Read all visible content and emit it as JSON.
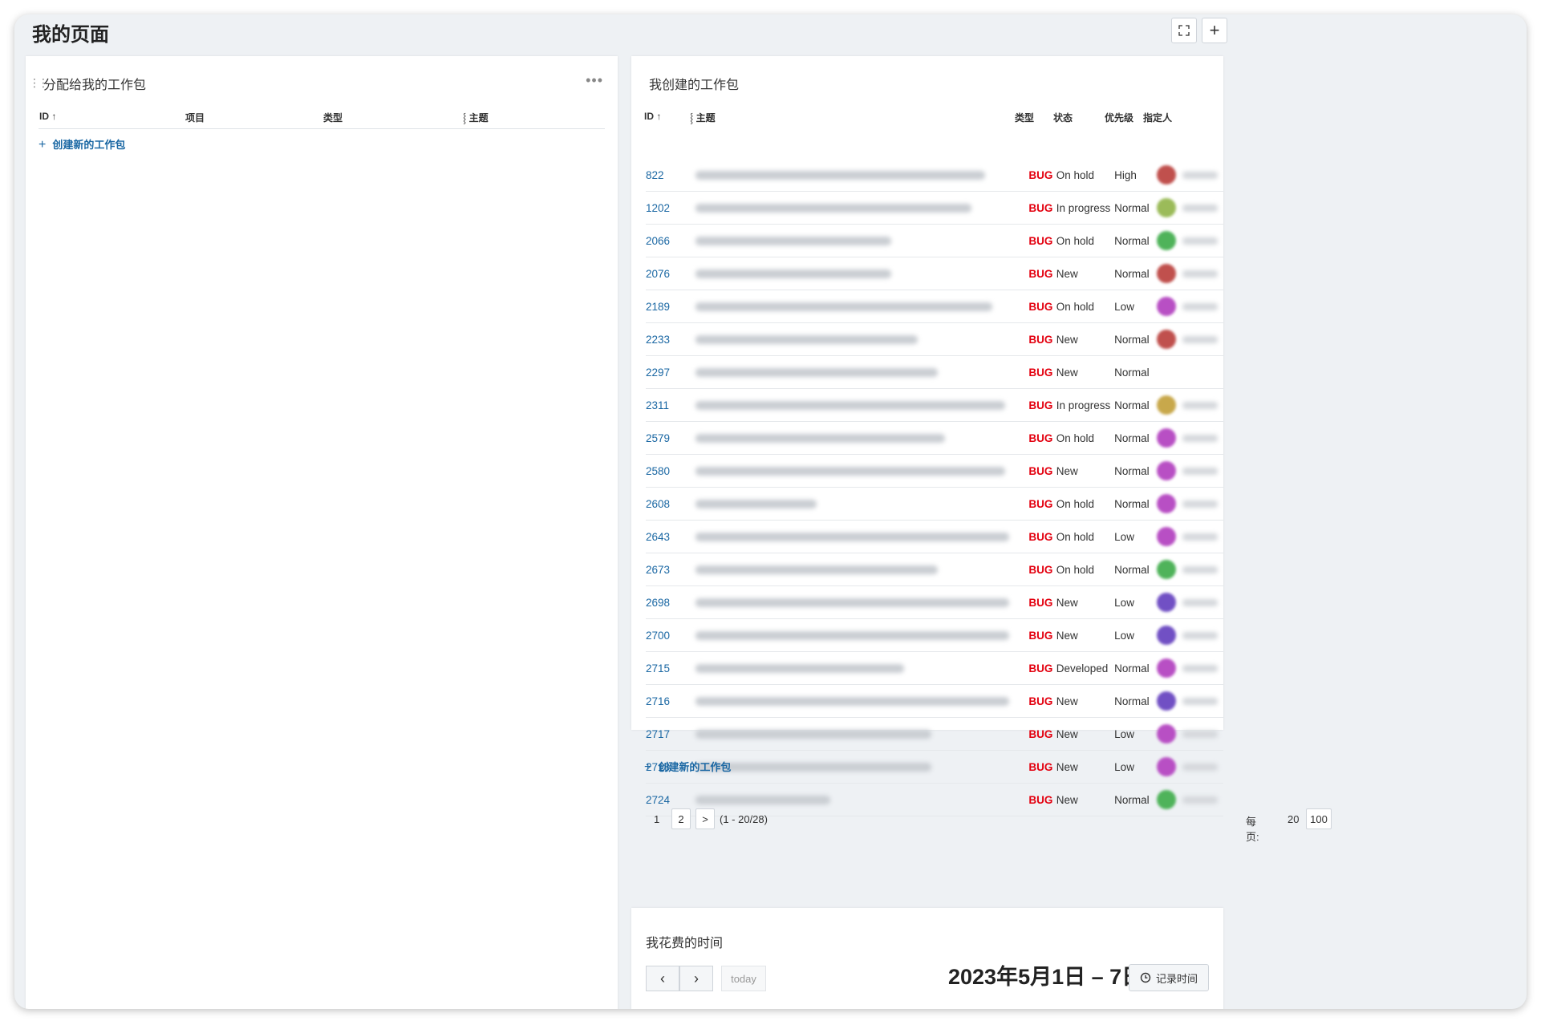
{
  "page": {
    "title": "我的页面",
    "fullscreen_icon": "expand-icon",
    "add_label": "+"
  },
  "assigned": {
    "title": "分配给我的工作包",
    "columns": [
      "ID",
      "项目",
      "类型",
      "主题"
    ],
    "create_label": "创建新的工作包"
  },
  "created": {
    "title": "我创建的工作包",
    "columns": {
      "id": "ID",
      "subject": "主题",
      "type": "类型",
      "status": "状态",
      "priority": "优先级",
      "assignee": "指定人"
    },
    "rows": [
      {
        "id": "822",
        "type": "BUG",
        "status": "On hold",
        "priority": "High",
        "avatar": "#c0504d",
        "subject_w": 0.86
      },
      {
        "id": "1202",
        "type": "BUG",
        "status": "In progress",
        "priority": "Normal",
        "avatar": "#9bbb59",
        "subject_w": 0.82
      },
      {
        "id": "2066",
        "type": "BUG",
        "status": "On hold",
        "priority": "Normal",
        "avatar": "#4fb35a",
        "subject_w": 0.58
      },
      {
        "id": "2076",
        "type": "BUG",
        "status": "New",
        "priority": "Normal",
        "avatar": "#c0504d",
        "subject_w": 0.58
      },
      {
        "id": "2189",
        "type": "BUG",
        "status": "On hold",
        "priority": "Low",
        "avatar": "#b84fc4",
        "subject_w": 0.88
      },
      {
        "id": "2233",
        "type": "BUG",
        "status": "New",
        "priority": "Normal",
        "avatar": "#c0504d",
        "subject_w": 0.66
      },
      {
        "id": "2297",
        "type": "BUG",
        "status": "New",
        "priority": "Normal",
        "avatar": "",
        "subject_w": 0.72
      },
      {
        "id": "2311",
        "type": "BUG",
        "status": "In progress",
        "priority": "Normal",
        "avatar": "#c8a84b",
        "subject_w": 0.92
      },
      {
        "id": "2579",
        "type": "BUG",
        "status": "On hold",
        "priority": "Normal",
        "avatar": "#b84fc4",
        "subject_w": 0.74
      },
      {
        "id": "2580",
        "type": "BUG",
        "status": "New",
        "priority": "Normal",
        "avatar": "#b84fc4",
        "subject_w": 0.92
      },
      {
        "id": "2608",
        "type": "BUG",
        "status": "On hold",
        "priority": "Normal",
        "avatar": "#b84fc4",
        "subject_w": 0.36
      },
      {
        "id": "2643",
        "type": "BUG",
        "status": "On hold",
        "priority": "Low",
        "avatar": "#b84fc4",
        "subject_w": 0.93
      },
      {
        "id": "2673",
        "type": "BUG",
        "status": "On hold",
        "priority": "Normal",
        "avatar": "#4fb35a",
        "subject_w": 0.72
      },
      {
        "id": "2698",
        "type": "BUG",
        "status": "New",
        "priority": "Low",
        "avatar": "#7150c4",
        "subject_w": 0.93
      },
      {
        "id": "2700",
        "type": "BUG",
        "status": "New",
        "priority": "Low",
        "avatar": "#7150c4",
        "subject_w": 0.93
      },
      {
        "id": "2715",
        "type": "BUG",
        "status": "Developed",
        "priority": "Normal",
        "avatar": "#b84fc4",
        "subject_w": 0.62
      },
      {
        "id": "2716",
        "type": "BUG",
        "status": "New",
        "priority": "Normal",
        "avatar": "#7150c4",
        "subject_w": 0.93
      },
      {
        "id": "2717",
        "type": "BUG",
        "status": "New",
        "priority": "Low",
        "avatar": "#b84fc4",
        "subject_w": 0.7
      },
      {
        "id": "2718",
        "type": "BUG",
        "status": "New",
        "priority": "Low",
        "avatar": "#b84fc4",
        "subject_w": 0.7
      },
      {
        "id": "2724",
        "type": "BUG",
        "status": "New",
        "priority": "Normal",
        "avatar": "#4fb35a",
        "subject_w": 0.4
      }
    ],
    "create_label": "创建新的工作包",
    "pagination": {
      "page1": "1",
      "page2": "2",
      "next": ">",
      "range": "(1 - 20/28)",
      "per_page_label": "每页:",
      "per_page_20": "20",
      "per_page_100": "100"
    }
  },
  "time": {
    "title": "我花费的时间",
    "prev": "‹",
    "next": "›",
    "today": "today",
    "range": "2023年5月1日 – 7日",
    "log_label": "记录时间"
  },
  "colors": {
    "bug": "#e3000f",
    "link": "#1a67a3",
    "background": "#eef1f4"
  }
}
